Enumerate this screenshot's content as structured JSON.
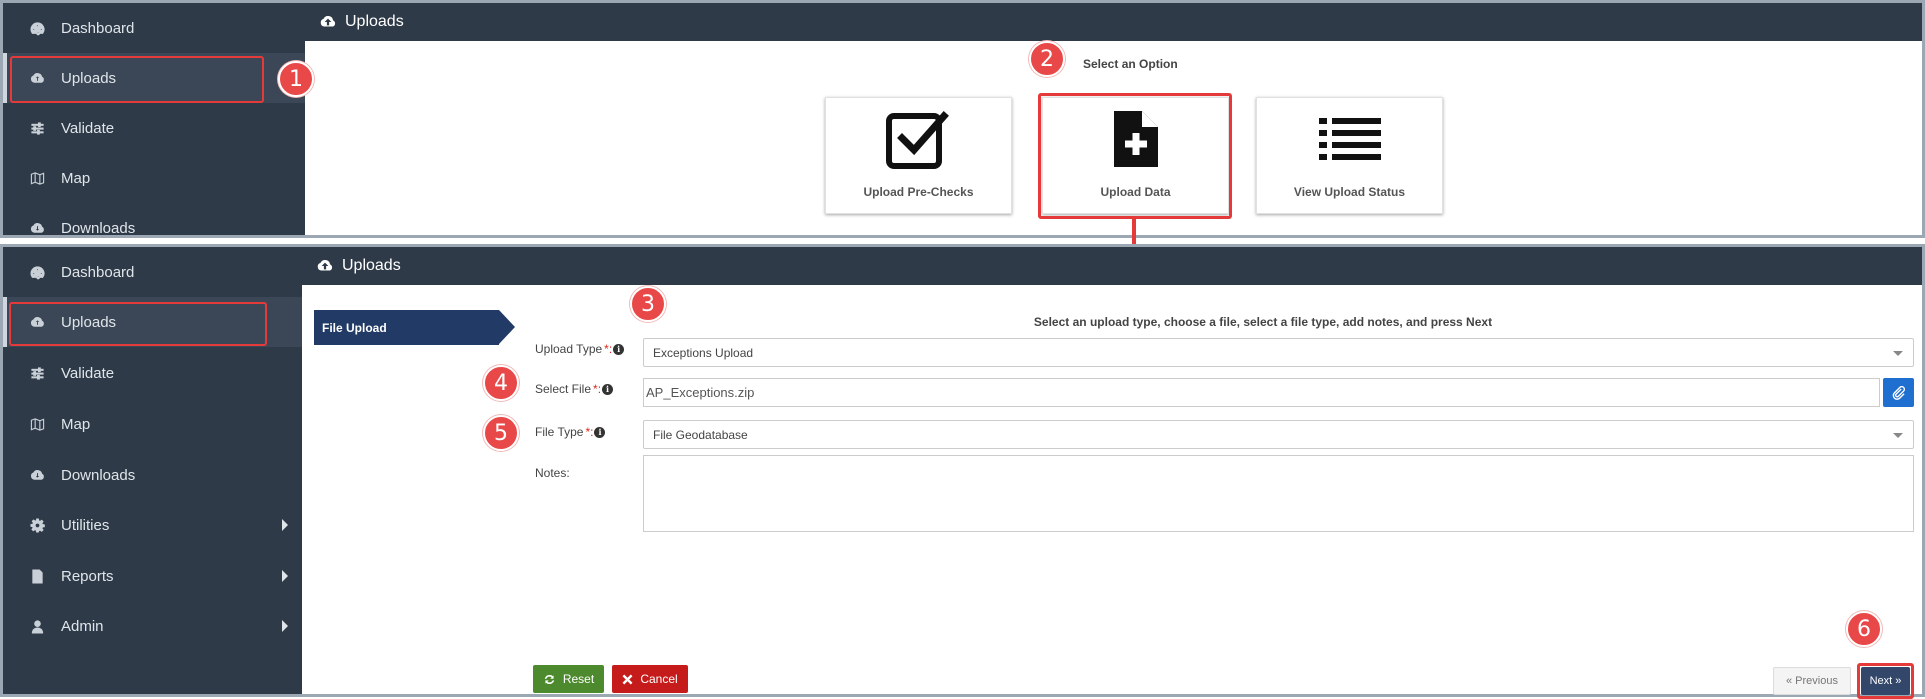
{
  "top_panel": {
    "sidebar": [
      {
        "label": "Dashboard",
        "icon": "dashboard-icon"
      },
      {
        "label": "Uploads",
        "icon": "cloud-upload-icon"
      },
      {
        "label": "Validate",
        "icon": "sliders-icon"
      },
      {
        "label": "Map",
        "icon": "map-icon"
      },
      {
        "label": "Downloads",
        "icon": "cloud-download-icon"
      }
    ],
    "header_title": "Uploads",
    "select_option_title": "Select an Option",
    "options": [
      {
        "label": "Upload Pre-Checks",
        "icon": "checkbox-icon"
      },
      {
        "label": "Upload Data",
        "icon": "file-plus-icon"
      },
      {
        "label": "View Upload Status",
        "icon": "list-icon"
      }
    ]
  },
  "bottom_panel": {
    "sidebar": [
      {
        "label": "Dashboard",
        "icon": "dashboard-icon"
      },
      {
        "label": "Uploads",
        "icon": "cloud-upload-icon"
      },
      {
        "label": "Validate",
        "icon": "sliders-icon"
      },
      {
        "label": "Map",
        "icon": "map-icon"
      },
      {
        "label": "Downloads",
        "icon": "cloud-download-icon"
      },
      {
        "label": "Utilities",
        "icon": "gear-icon"
      },
      {
        "label": "Reports",
        "icon": "file-icon"
      },
      {
        "label": "Admin",
        "icon": "user-icon"
      }
    ],
    "header_title": "Uploads",
    "wizard_step": "File Upload",
    "instructions": "Select an upload type, choose a file, select a file type, add notes, and press Next",
    "form": {
      "upload_type_label": "Upload Type",
      "upload_type_value": "Exceptions Upload",
      "select_file_label": "Select File",
      "select_file_value": "AP_Exceptions.zip",
      "file_type_label": "File Type",
      "file_type_value": "File Geodatabase",
      "notes_label": "Notes:",
      "required_mark": "*:",
      "info_mark": "i"
    },
    "buttons": {
      "reset": "Reset",
      "cancel": "Cancel",
      "previous": "« Previous",
      "next": "Next »"
    }
  },
  "callouts": [
    "1",
    "2",
    "3",
    "4",
    "5",
    "6"
  ],
  "colors": {
    "sidebar_bg": "#2e3a48",
    "highlight": "#e53a3a",
    "wizard_step_bg": "#223a66",
    "reset_green": "#4d8a2d",
    "cancel_red": "#c61b1b",
    "next_navy": "#33476b",
    "attach_blue": "#1f6fd1"
  }
}
